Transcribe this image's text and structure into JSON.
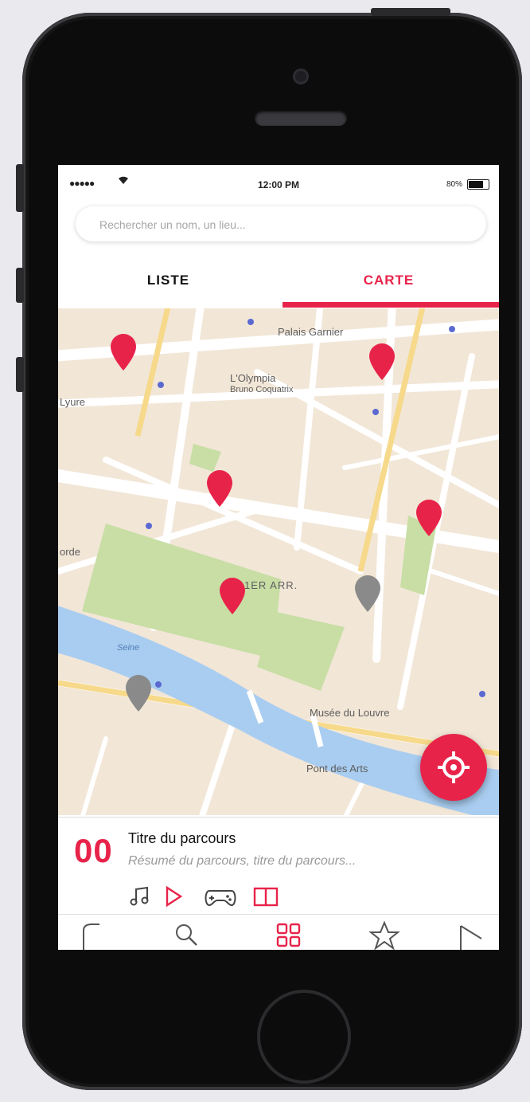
{
  "status_bar": {
    "signal": "●●●●●",
    "wifi_icon": "wifi-icon",
    "time": "12:00 PM",
    "battery_percent": "80%"
  },
  "search": {
    "placeholder": "Rechercher un nom, un lieu..."
  },
  "tabs": [
    {
      "label": "LISTE",
      "active": false
    },
    {
      "label": "CARTE",
      "active": true
    }
  ],
  "map": {
    "labels": {
      "palais_garnier": "Palais Garnier",
      "olympia": "L'Olympia",
      "olympia_sub": "Bruno Coquatrix",
      "lyure": "Lyure",
      "arr": "1ER ARR.",
      "orde": "orde",
      "seine": "Seine",
      "musee": "Musée du Louvre",
      "pont": "Pont des Arts"
    },
    "red_pins": 5,
    "grey_pins": 2,
    "accent_color": "#e8234a",
    "grey_pin_color": "#8a8a8a"
  },
  "locate_button": {
    "icon": "crosshair-icon"
  },
  "route_card": {
    "number": "00",
    "title": "Titre du parcours",
    "subtitle": "Résumé du parcours, titre du parcours...",
    "icons": [
      "music-icon",
      "play-icon",
      "gamepad-icon",
      "book-icon"
    ]
  },
  "tabbar": {
    "items": [
      {
        "icon": "bookmark-icon",
        "active": false
      },
      {
        "icon": "search-icon",
        "active": false
      },
      {
        "icon": "grid-icon",
        "active": true
      },
      {
        "icon": "star-icon",
        "active": false
      },
      {
        "icon": "play-icon",
        "active": false
      }
    ]
  },
  "colors": {
    "accent": "#e8234a",
    "map_bg": "#f2e6d7",
    "park": "#c8dea5",
    "water": "#a9cdf0"
  }
}
